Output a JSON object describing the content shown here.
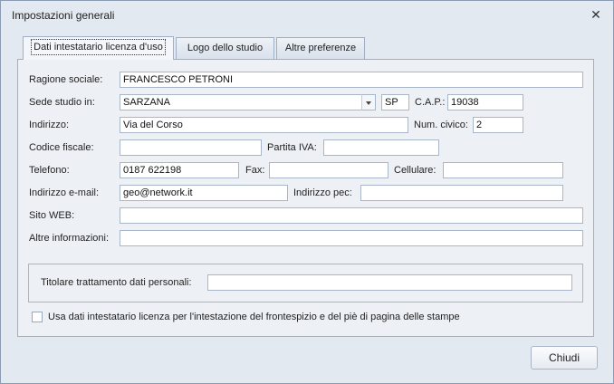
{
  "window": {
    "title": "Impostazioni generali",
    "close_glyph": "✕"
  },
  "tabs": [
    {
      "label": "Dati intestatario licenza d'uso"
    },
    {
      "label": "Logo dello studio"
    },
    {
      "label": "Altre preferenze"
    }
  ],
  "form": {
    "ragione_sociale": {
      "label": "Ragione sociale:",
      "value": "FRANCESCO PETRONI"
    },
    "sede": {
      "label": "Sede studio in:",
      "value": "SARZANA",
      "prov": "SP"
    },
    "cap": {
      "label": "C.A.P.:",
      "value": "19038"
    },
    "indirizzo": {
      "label": "Indirizzo:",
      "value": "Via del Corso"
    },
    "num_civico": {
      "label": "Num. civico:",
      "value": "2"
    },
    "codice_fiscale": {
      "label": "Codice fiscale:",
      "value": ""
    },
    "partita_iva": {
      "label": "Partita IVA:",
      "value": ""
    },
    "telefono": {
      "label": "Telefono:",
      "value": "0187 622198"
    },
    "fax": {
      "label": "Fax:",
      "value": ""
    },
    "cellulare": {
      "label": "Cellulare:",
      "value": ""
    },
    "email": {
      "label": "Indirizzo e-mail:",
      "value": "geo@network.it"
    },
    "pec": {
      "label": "Indirizzo pec:",
      "value": ""
    },
    "sito": {
      "label": "Sito WEB:",
      "value": ""
    },
    "altre_info": {
      "label": "Altre informazioni:",
      "value": ""
    },
    "titolare": {
      "label": "Titolare trattamento dati personali:",
      "value": ""
    },
    "usa_dati": {
      "label": "Usa dati intestatario licenza per l'intestazione del frontespizio e del piè di pagina delle stampe",
      "checked": false
    }
  },
  "buttons": {
    "close_label": "Chiudi"
  }
}
